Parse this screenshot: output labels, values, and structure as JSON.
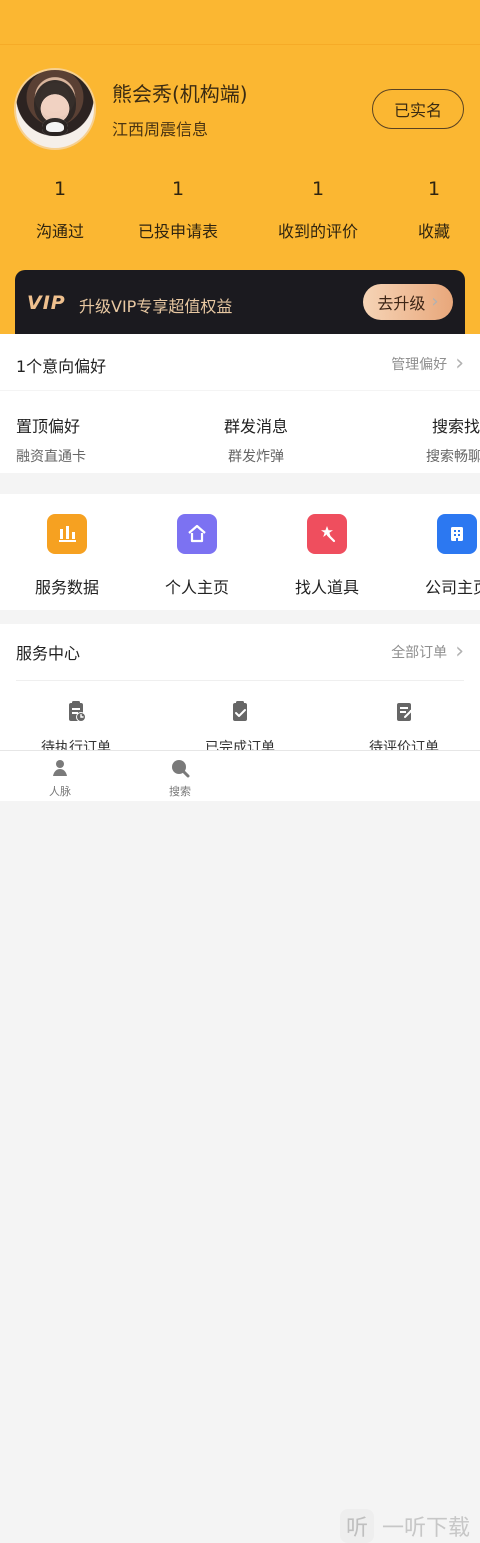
{
  "profile": {
    "name": "熊会秀(机构端)",
    "company": "江西周震信息",
    "verified_label": "已实名"
  },
  "stats": [
    {
      "value": "1",
      "label": "沟通过"
    },
    {
      "value": "1",
      "label": "已投申请表"
    },
    {
      "value": "1",
      "label": "收到的评价"
    },
    {
      "value": "1",
      "label": "收藏"
    }
  ],
  "vip": {
    "badge": "VIP",
    "text": "升级VIP专享超值权益",
    "button_label": "去升级"
  },
  "preference": {
    "title": "1个意向偏好",
    "manage_label": "管理偏好"
  },
  "features": [
    {
      "title": "置顶偏好",
      "subtitle": "融资直通卡"
    },
    {
      "title": "群发消息",
      "subtitle": "群发炸弹"
    },
    {
      "title": "搜索找人",
      "subtitle": "搜索畅聊卡"
    }
  ],
  "quick_links": [
    {
      "label": "服务数据",
      "icon": "bar-chart-icon",
      "color": "#f6a121"
    },
    {
      "label": "个人主页",
      "icon": "home-icon",
      "color": "#7c72f2"
    },
    {
      "label": "找人道具",
      "icon": "star-wand-icon",
      "color": "#ef4e5e"
    },
    {
      "label": "公司主页",
      "icon": "building-icon",
      "color": "#2c78f1"
    }
  ],
  "service_center": {
    "title": "服务中心",
    "all_orders_label": "全部订单",
    "items": [
      {
        "label": "待执行订单",
        "icon": "clipboard-clock-icon"
      },
      {
        "label": "已完成订单",
        "icon": "clipboard-check-icon"
      },
      {
        "label": "待评价订单",
        "icon": "clipboard-edit-icon"
      }
    ]
  },
  "bottom_nav": [
    {
      "label": "人脉",
      "icon": "people-icon"
    },
    {
      "label": "搜索",
      "icon": "search-chat-icon"
    }
  ],
  "watermark": {
    "glyph": "听",
    "text": "一听下载"
  }
}
